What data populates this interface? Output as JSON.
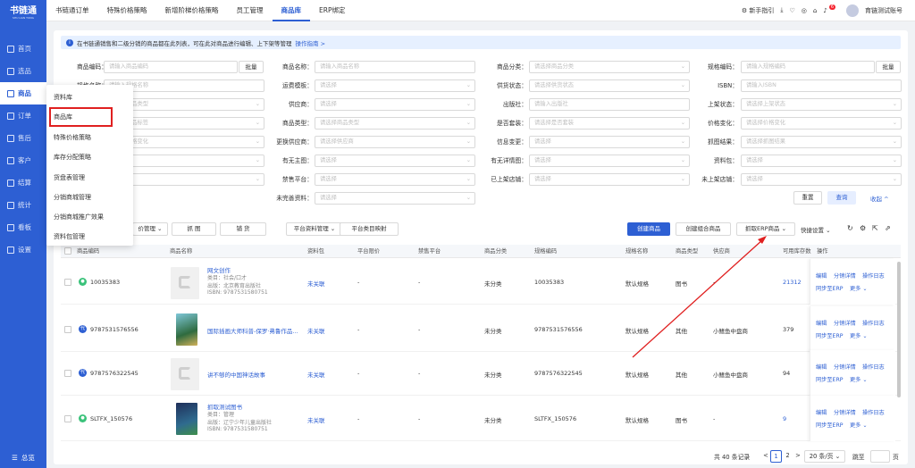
{
  "sidebar": {
    "logo": "书链通",
    "logo_sub": "SHU LIAN TONG",
    "items": [
      {
        "label": "首页"
      },
      {
        "label": "选品"
      },
      {
        "label": "商品"
      },
      {
        "label": "订单"
      },
      {
        "label": "售后"
      },
      {
        "label": "客户"
      },
      {
        "label": "结算"
      },
      {
        "label": "统计"
      },
      {
        "label": "看板"
      },
      {
        "label": "设置"
      }
    ],
    "footer": "总览"
  },
  "tabs": [
    {
      "label": "书链通订单"
    },
    {
      "label": "特殊价格策略"
    },
    {
      "label": "新增阶梯价格策略"
    },
    {
      "label": "员工管理"
    },
    {
      "label": "商品库"
    },
    {
      "label": "ERP绑定"
    }
  ],
  "topright": {
    "guide": "新手指引",
    "badge": "6",
    "account": "育链测试账号"
  },
  "notice": {
    "text": "在书链通销售和二级分销的商品都在此列表，可在此对商品进行编辑、上下架等管理",
    "link": "操作指南 >"
  },
  "filters": {
    "f1": "商品编码：",
    "f1p": "请输入商品编码",
    "batch": "批量",
    "f2": "商品名称：",
    "f2p": "请输入商品名称",
    "f3": "商品分类：",
    "f3p": "请选择商品分类",
    "f4": "规格编码：",
    "f4p": "请输入规格编码",
    "f5": "规格名称：",
    "f5p": "请输入规格名称",
    "f6": "运费模板：",
    "f6p": "请选择",
    "f7": "供货状态：",
    "f7p": "请选择供货状态",
    "f8": "ISBN：",
    "f8p": "请输入ISBN",
    "f9p": "请选择商品类型",
    "f10": "供应商：",
    "f10p": "请选择",
    "f11": "出版社：",
    "f11p": "请输入出版社",
    "f12": "上架状态：",
    "f12p": "请选择上架状态",
    "f13p": "请选择商品标签",
    "f14": "商品类型：",
    "f14p": "请选择商品类型",
    "f15": "是否套装：",
    "f15p": "请选择是否套装",
    "f16": "价格变化：",
    "f16p": "请选择价格变化",
    "f17p": "请选择价格变化",
    "f18": "更换供应商：",
    "f18p": "请选择供应商",
    "f19": "信息变更：",
    "f19p": "请选择",
    "f20": "抓图结果：",
    "f20p": "请选择抓图结果",
    "f21": "有无主图：",
    "f21p": "请选择",
    "f22": "有无详情图：",
    "f22p": "请选择",
    "f23": "资料包：",
    "f23p": "请选择",
    "f24": "禁售平台：",
    "f24p": "请选择",
    "f25": "已上架店铺：",
    "f25p": "请选择",
    "f26": "未上架店铺：",
    "f26p": "请选择",
    "f27": "未完善资料：",
    "f27p": "请选择",
    "reset": "重置",
    "search": "查询",
    "collapse": "收起 ^"
  },
  "toolbar": {
    "b1": "价管理 ⌄",
    "b2": "抓 图",
    "b3": "铺 货",
    "b4": "平台资料管理 ⌄",
    "b5": "平台类目映射",
    "create": "创建商品",
    "create_combo": "创建组合商品",
    "fetch_erp": "抓取ERP商品 ⌄",
    "quick": "快捷设置 ⌄"
  },
  "table": {
    "headers": [
      "商品编码",
      "商品名称",
      "资料包",
      "平台限价",
      "禁售平台",
      "商品分类",
      "规格编码",
      "规格名称",
      "商品类型",
      "供应商",
      "可用库存数",
      "操作"
    ],
    "rows": [
      {
        "code": "10035383",
        "name": "网文创作",
        "line2": "类目：社会/口才",
        "line3": "出版：北京教育出版社",
        "line4": "ISBN: 9787531580751",
        "pkg": "未关联",
        "lim": "-",
        "ban": "-",
        "cat": "未分类",
        "skuc": "10035383",
        "skun": "默认规格",
        "type": "图书",
        "sup": "-",
        "stock": "21312",
        "shop": "🟢"
      },
      {
        "code": "9787531576556",
        "name": "国际插画大师科普-保罗·弗鲁作品...",
        "line2": "",
        "line3": "",
        "line4": "",
        "pkg": "未关联",
        "lim": "-",
        "ban": "-",
        "cat": "未分类",
        "skuc": "9787531576556",
        "skun": "默认规格",
        "type": "其他",
        "sup": "小鳍鱼中盘商",
        "stock": "379",
        "shop": "代"
      },
      {
        "code": "9787576322545",
        "name": "讲不够的中国神话故事",
        "line2": "",
        "line3": "",
        "line4": "",
        "pkg": "未关联",
        "lim": "-",
        "ban": "-",
        "cat": "未分类",
        "skuc": "9787576322545",
        "skun": "默认规格",
        "type": "其他",
        "sup": "小鳍鱼中盘商",
        "stock": "94",
        "shop": "代"
      },
      {
        "code": "SLTFX_150576",
        "name": "抓取测试图书",
        "line2": "类目：管理",
        "line3": "出版：辽宁少年儿童出版社",
        "line4": "ISBN: 9787531580751",
        "pkg": "未关联",
        "lim": "-",
        "ban": "-",
        "cat": "未分类",
        "skuc": "SLTFX_150576",
        "skun": "默认规格",
        "type": "图书",
        "sup": "-",
        "stock": "9",
        "shop": "🟢"
      }
    ],
    "ops": {
      "edit": "编辑",
      "detail": "分销详情",
      "log": "操作日志",
      "sync": "同步至ERP",
      "more": "更多 ⌄"
    }
  },
  "pager": {
    "total": "共 40 条记录",
    "p1": "1",
    "p2": "2",
    "next": ">",
    "size": "20 条/页 ⌄",
    "jump": "跳至",
    "page": "页"
  },
  "dropdown": [
    "资料库",
    "商品库",
    "特殊价格策略",
    "库存分配策略",
    "货盘表管理",
    "分销商城管理",
    "分销商城推广效果",
    "资料包管理"
  ]
}
